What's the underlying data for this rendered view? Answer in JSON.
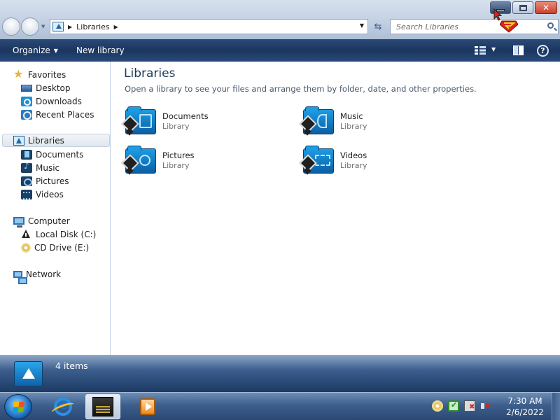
{
  "window": {
    "buttons": {
      "minimize": "minimize-icon",
      "maximize": "maximize-icon",
      "close": "close-icon"
    }
  },
  "address": {
    "breadcrumb": [
      "Libraries"
    ],
    "search_placeholder": "Search Libraries"
  },
  "toolbar": {
    "organize_label": "Organize",
    "new_library_label": "New library"
  },
  "sidebar": {
    "favorites": {
      "label": "Favorites",
      "items": [
        {
          "label": "Desktop",
          "icon": "desktop-icon"
        },
        {
          "label": "Downloads",
          "icon": "downloads-icon"
        },
        {
          "label": "Recent Places",
          "icon": "recent-places-icon"
        }
      ]
    },
    "libraries": {
      "label": "Libraries",
      "items": [
        {
          "label": "Documents",
          "icon": "documents-library-icon"
        },
        {
          "label": "Music",
          "icon": "music-library-icon"
        },
        {
          "label": "Pictures",
          "icon": "pictures-library-icon"
        },
        {
          "label": "Videos",
          "icon": "videos-library-icon"
        }
      ]
    },
    "computer": {
      "label": "Computer",
      "items": [
        {
          "label": "Local Disk (C:)",
          "icon": "local-disk-icon"
        },
        {
          "label": "CD Drive (E:)",
          "icon": "cd-drive-icon"
        }
      ]
    },
    "network": {
      "label": "Network"
    }
  },
  "main": {
    "title": "Libraries",
    "subtitle": "Open a library to see your files and arrange them by folder, date, and other properties.",
    "libraries": [
      {
        "name": "Documents",
        "type": "Library",
        "icon": "documents-library-icon"
      },
      {
        "name": "Music",
        "type": "Library",
        "icon": "music-library-icon"
      },
      {
        "name": "Pictures",
        "type": "Library",
        "icon": "pictures-library-icon"
      },
      {
        "name": "Videos",
        "type": "Library",
        "icon": "videos-library-icon"
      }
    ]
  },
  "details": {
    "item_count": "4 items"
  },
  "taskbar": {
    "apps": [
      "internet-explorer-icon",
      "windows-explorer-icon",
      "media-player-icon"
    ],
    "clock_time": "7:30 AM",
    "clock_date": "2/6/2022"
  },
  "colors": {
    "accent": "#1c9ce3",
    "command_bar": "#1b355e",
    "title_text": "#1e395b"
  }
}
